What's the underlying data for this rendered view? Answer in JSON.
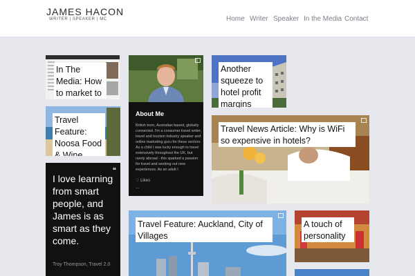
{
  "header": {
    "brand_name": "JAMES HACON",
    "brand_tagline": "WRITER | SPEAKER | MC",
    "nav": [
      "Home",
      "Writer",
      "Speaker",
      "In the Media",
      "Contact"
    ]
  },
  "tiles": {
    "media": {
      "label": "In The Media: How to market to"
    },
    "about": {
      "title": "About Me",
      "body": "British born, Australian based, globally connected. I'm a consumer travel writer, travel and tourism industry speaker and online marketing guru for these sectors. As a child I was lucky enough to travel extensively throughout the UK, but rarely abroad - this sparked a passion for travel and seeking out new experiences. As an adult I",
      "likes": "Likes",
      "more": "..."
    },
    "squeeze": {
      "label": "Another squeeze to hotel profit margins"
    },
    "noosa": {
      "label": "Travel Feature: Noosa Food & Wine"
    },
    "wifi": {
      "label": "Travel News Article: Why is WiFi so expensive in hotels?"
    },
    "quote": {
      "text": "I love learning from smart people, and James is as smart as they come.",
      "author": "Troy Thompson, Travel 2.0"
    },
    "auckland": {
      "label": "Travel Feature: Auckland, City of Villages"
    },
    "personality": {
      "label": "A touch of personality"
    }
  },
  "colors": {
    "page_bg": "#e6e8ed",
    "header_bg": "#ffffff",
    "nav_text": "#7a7f88",
    "dark_tile": "#111111"
  }
}
